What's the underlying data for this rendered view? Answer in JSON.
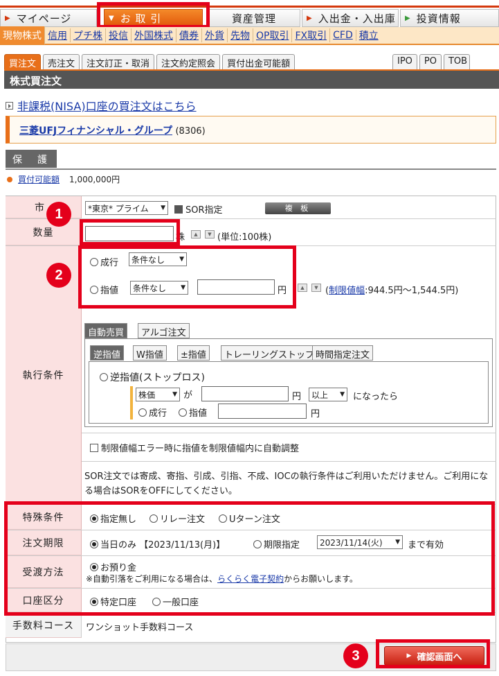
{
  "topnav": {
    "items": [
      "マイページ",
      "お 取 引",
      "資産管理",
      "入出金・入出庫",
      "投資情報"
    ]
  },
  "subnav": {
    "items": [
      "現物株式",
      "信用",
      "プチ株",
      "投信",
      "外国株式",
      "債券",
      "外貨",
      "先物",
      "OP取引",
      "FX取引",
      "CFD",
      "積立"
    ]
  },
  "order_tabs": [
    "買注文",
    "売注文",
    "注文訂正・取消",
    "注文約定照会",
    "買付出金可能額"
  ],
  "right_tabs": [
    "IPO",
    "PO",
    "TOB"
  ],
  "section_title": "株式買注文",
  "nisa_link": "非課税(NISA)口座の買注文はこちら",
  "stock": {
    "name": "三菱UFJフィナンシャル・グループ",
    "code": "(8306)"
  },
  "hogo_label": "保　護",
  "kaitsuke": {
    "label": "買付可能額",
    "value": "1,000,000円"
  },
  "form": {
    "market_label": "市",
    "market_value": "*東京* プライム",
    "sor_label": "SOR指定",
    "fukuban_label": "複 板",
    "quantity_label": "数量",
    "quantity_unit": "株",
    "quantity_note": "(単位:100株)",
    "exec_label": "執行条件",
    "nariyuki_label": "成行",
    "nariyuki_cond": "条件なし",
    "sashine_label": "指値",
    "sashine_cond": "条件なし",
    "yen": "円",
    "limit_note_prefix": "(",
    "limit_link": "制限値幅",
    "limit_note_suffix": ":944.5円～1,544.5円)",
    "algo_tabs": [
      "自動売買",
      "アルゴ注文"
    ],
    "stop_tabs": [
      "逆指値",
      "W指値",
      "±指値",
      "トレーリングストップ",
      "時間指定注文"
    ],
    "stop_loss_label": "逆指値(ストップロス)",
    "trigger_select": "株価",
    "ga": "が",
    "ijou": "以上",
    "nattara": "になったら",
    "stop_nariyuki": "成行",
    "stop_sashine": "指値",
    "auto_adjust": "制限値幅エラー時に指値を制限値幅内に自動調整",
    "sor_note": "SOR注文では寄成、寄指、引成、引指、不成、IOCの執行条件はご利用いただけません。ご利用になる場合はSORをOFFにしてください。",
    "special_label": "特殊条件",
    "special_options": [
      "指定無し",
      "リレー注文",
      "Uターン注文"
    ],
    "period_label": "注文期限",
    "period_today": "当日のみ 【2023/11/13(月)】",
    "period_specify": "期限指定",
    "period_date": "2023/11/14(火)",
    "period_suffix": "まで有効",
    "delivery_label": "受渡方法",
    "delivery_value": "お預り金",
    "delivery_note_prefix": "※自動引落をご利用になる場合は、",
    "delivery_note_link": "らくらく電子契約",
    "delivery_note_suffix": "からお願いします。",
    "account_label": "口座区分",
    "account_options": [
      "特定口座",
      "一般口座"
    ],
    "fee_label": "手数料コース",
    "fee_value": "ワンショット手数料コース"
  },
  "confirm_button": "確認画面へ",
  "callouts": [
    "1",
    "2",
    "3"
  ],
  "colors": {
    "accent": "#e86f19",
    "highlight": "#e4001b",
    "label_bg": "#fbe1e1"
  }
}
